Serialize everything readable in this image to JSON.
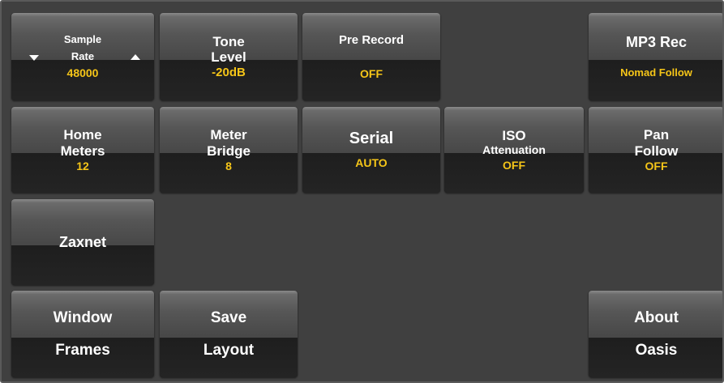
{
  "colors": {
    "panel": "#404040",
    "value_text": "#f5c518",
    "label_text": "#ffffff"
  },
  "buttons": {
    "sample_rate": {
      "line1": "Sample",
      "line2": "Rate",
      "value": "48000",
      "icons": [
        "triangle-down-icon",
        "triangle-up-icon"
      ]
    },
    "tone_level": {
      "line1": "Tone",
      "line2": "Level",
      "value": "-20dB"
    },
    "pre_record": {
      "label": "Pre Record",
      "value": "OFF"
    },
    "mp3_rec": {
      "label": "MP3 Rec",
      "value": "Nomad Follow"
    },
    "home_meters": {
      "line1": "Home",
      "line2": "Meters",
      "value": "12"
    },
    "meter_bridge": {
      "line1": "Meter",
      "line2": "Bridge",
      "value": "8"
    },
    "serial": {
      "label": "Serial",
      "value": "AUTO"
    },
    "iso_attenuation": {
      "line1": "ISO",
      "line2": "Attenuation",
      "value": "OFF"
    },
    "pan_follow": {
      "line1": "Pan",
      "line2": "Follow",
      "value": "OFF"
    },
    "zaxnet": {
      "label": "Zaxnet"
    },
    "window_frames": {
      "line1": "Window",
      "line2": "Frames"
    },
    "save_layout": {
      "line1": "Save",
      "line2": "Layout"
    },
    "about_oasis": {
      "line1": "About",
      "line2": "Oasis"
    }
  }
}
